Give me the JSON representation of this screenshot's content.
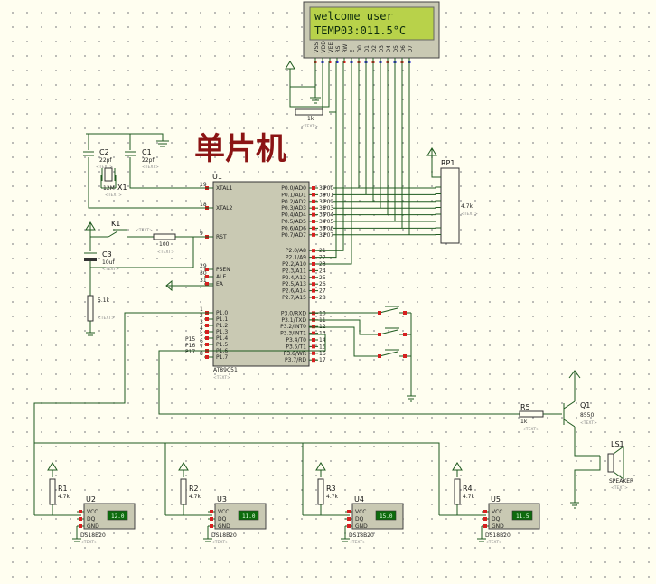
{
  "title": "单片机",
  "lcd": {
    "line1": "welcome user",
    "line2": "TEMP03:011.5°C",
    "pins": [
      "VSS",
      "VDD",
      "VEE",
      "RS",
      "RW",
      "E",
      "D0",
      "D1",
      "D2",
      "D3",
      "D4",
      "D5",
      "D6",
      "D7"
    ]
  },
  "mcu": {
    "ref": "U1",
    "part": "AT89C51",
    "text": "<TEXT>",
    "left_pins": [
      {
        "num": "19",
        "name": "XTAL1"
      },
      {
        "num": "18",
        "name": "XTAL2"
      },
      {
        "num": "9",
        "name": "RST"
      },
      {
        "num": "29",
        "name": "PSEN"
      },
      {
        "num": "30",
        "name": "ALE"
      },
      {
        "num": "31",
        "name": "EA"
      },
      {
        "num": "1",
        "name": "P1.0"
      },
      {
        "num": "2",
        "name": "P1.1"
      },
      {
        "num": "3",
        "name": "P1.2"
      },
      {
        "num": "4",
        "name": "P1.3"
      },
      {
        "num": "5",
        "name": "P1.4"
      },
      {
        "num": "6",
        "name": "P1.5"
      },
      {
        "num": "7",
        "name": "P1.6"
      },
      {
        "num": "8",
        "name": "P1.7"
      }
    ],
    "right_pins": [
      {
        "num": "39",
        "name": "P0.0/AD0"
      },
      {
        "num": "38",
        "name": "P0.1/AD1"
      },
      {
        "num": "37",
        "name": "P0.2/AD2"
      },
      {
        "num": "36",
        "name": "P0.3/AD3"
      },
      {
        "num": "35",
        "name": "P0.4/AD4"
      },
      {
        "num": "34",
        "name": "P0.5/AD5"
      },
      {
        "num": "33",
        "name": "P0.6/AD6"
      },
      {
        "num": "32",
        "name": "P0.7/AD7"
      },
      {
        "num": "21",
        "name": "P2.0/A8"
      },
      {
        "num": "22",
        "name": "P2.1/A9"
      },
      {
        "num": "23",
        "name": "P2.2/A10"
      },
      {
        "num": "24",
        "name": "P2.3/A11"
      },
      {
        "num": "25",
        "name": "P2.4/A12"
      },
      {
        "num": "26",
        "name": "P2.5/A13"
      },
      {
        "num": "27",
        "name": "P2.6/A14"
      },
      {
        "num": "28",
        "name": "P2.7/A15"
      },
      {
        "num": "10",
        "name": "P3.0/RXD"
      },
      {
        "num": "11",
        "name": "P3.1/TXD"
      },
      {
        "num": "12",
        "name": "P3.2/INT0"
      },
      {
        "num": "13",
        "name": "P3.3/INT1"
      },
      {
        "num": "14",
        "name": "P3.4/T0"
      },
      {
        "num": "15",
        "name": "P3.5/T1"
      },
      {
        "num": "16",
        "name": "P3.6/WR"
      },
      {
        "num": "17",
        "name": "P3.7/RD"
      }
    ],
    "p0_nets": [
      "P00",
      "P01",
      "P02",
      "P03",
      "P04",
      "P05",
      "P06",
      "P07"
    ],
    "p1_nets": [
      "P15",
      "P16",
      "P17"
    ]
  },
  "components": {
    "c1": {
      "ref": "C1",
      "value": "22pf"
    },
    "c2": {
      "ref": "C2",
      "value": "22pf"
    },
    "x1": {
      "ref": "X1",
      "value": "12M"
    },
    "c3": {
      "ref": "C3",
      "value": "10uf"
    },
    "k1": {
      "ref": "K1"
    },
    "r_rst": {
      "value": "100"
    },
    "r_pull": {
      "value": "5.1k"
    },
    "r_lcd": {
      "value": "1k"
    },
    "rp1": {
      "ref": "RP1",
      "value": "4.7k"
    },
    "r5": {
      "ref": "R5",
      "value": "1k"
    },
    "q1": {
      "ref": "Q1",
      "value": "8550"
    },
    "ls1": {
      "ref": "LS1",
      "value": "SPEAKER"
    },
    "text_tag": "<TEXT>"
  },
  "sensors": [
    {
      "r_ref": "R1",
      "r_val": "4.7k",
      "u_ref": "U2",
      "reading": "12.0",
      "part": "DS18B20"
    },
    {
      "r_ref": "R2",
      "r_val": "4.7k",
      "u_ref": "U3",
      "reading": "11.0",
      "part": "DS18B20"
    },
    {
      "r_ref": "R3",
      "r_val": "4.7k",
      "u_ref": "U4",
      "reading": "15.0",
      "part": "DS18B20"
    },
    {
      "r_ref": "R4",
      "r_val": "4.7k",
      "u_ref": "U5",
      "reading": "11.5",
      "part": "DS18B20"
    }
  ],
  "ds_pins": [
    "VCC",
    "DQ",
    "GND"
  ]
}
